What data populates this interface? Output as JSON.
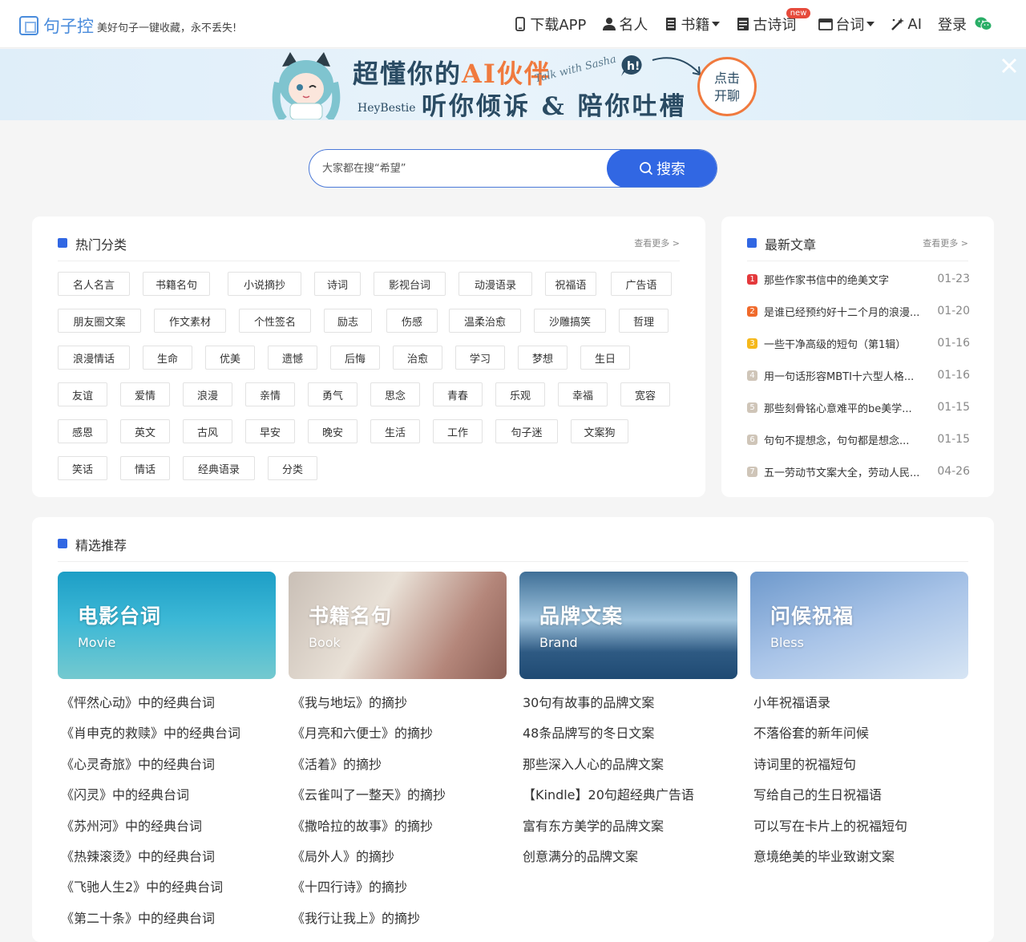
{
  "header": {
    "logo_name": "句子控",
    "slogan": "美好句子一键收藏，永不丢失!",
    "nav": [
      {
        "label": "下载APP",
        "icon": "phone-icon"
      },
      {
        "label": "名人",
        "icon": "person-icon"
      },
      {
        "label": "书籍",
        "icon": "book-icon",
        "dropdown": true
      },
      {
        "label": "古诗词",
        "icon": "document-icon",
        "badge": "new"
      },
      {
        "label": "台词",
        "icon": "clapper-icon",
        "dropdown": true
      },
      {
        "label": "AI",
        "icon": "magic-wand-icon"
      },
      {
        "label": "登录"
      }
    ]
  },
  "banner": {
    "title_pre": "超懂你的",
    "title_ai": "AI伙伴",
    "script": "Talk with Sasha",
    "subtitle": "听你倾诉 & 陪你吐槽",
    "brand": "HeyBestie",
    "cta": [
      "点击",
      "开聊"
    ]
  },
  "search": {
    "placeholder": "大家都在搜“希望”",
    "button": "搜索"
  },
  "hot": {
    "title": "热门分类",
    "more": "查看更多 >",
    "tags": [
      "名人名言",
      "书籍名句",
      "小说摘抄",
      "诗词",
      "影视台词",
      "动漫语录",
      "祝福语",
      "广告语",
      "朋友圈文案",
      "作文素材",
      "个性签名",
      "励志",
      "伤感",
      "温柔治愈",
      "沙雕搞笑",
      "哲理",
      "浪漫情话",
      "生命",
      "优美",
      "遗憾",
      "后悔",
      "治愈",
      "学习",
      "梦想",
      "生日",
      "友谊",
      "爱情",
      "浪漫",
      "亲情",
      "勇气",
      "思念",
      "青春",
      "乐观",
      "幸福",
      "宽容",
      "感恩",
      "英文",
      "古风",
      "早安",
      "晚安",
      "生活",
      "工作",
      "句子迷",
      "文案狗",
      "笑话",
      "情话",
      "经典语录",
      "分类"
    ]
  },
  "latest": {
    "title": "最新文章",
    "more": "查看更多 >",
    "articles": [
      {
        "rank": "1",
        "title": "那些作家书信中的绝美文字",
        "date": "01-23",
        "color": "#e4393c"
      },
      {
        "rank": "2",
        "title": "是谁已经预约好十二个月的浪漫...",
        "date": "01-20",
        "color": "#f06a2b"
      },
      {
        "rank": "3",
        "title": "一些干净高级的短句（第1辑）",
        "date": "01-16",
        "color": "#f5b81b"
      },
      {
        "rank": "4",
        "title": "用一句话形容MBTI十六型人格...",
        "date": "01-16",
        "color": "#cfc5b8"
      },
      {
        "rank": "5",
        "title": "那些刻骨铭心意难平的be美学...",
        "date": "01-15",
        "color": "#cfc5b8"
      },
      {
        "rank": "6",
        "title": "句句不提想念，句句都是想念...",
        "date": "01-15",
        "color": "#cfc5b8"
      },
      {
        "rank": "7",
        "title": "五一劳动节文案大全，劳动人民...",
        "date": "04-26",
        "color": "#cfc5b8"
      }
    ]
  },
  "featured": {
    "title": "精选推荐",
    "columns": [
      {
        "title": "电影台词",
        "sub": "Movie",
        "links": [
          "《怦然心动》中的经典台词",
          "《肖申克的救赎》中的经典台词",
          "《心灵奇旅》中的经典台词",
          "《闪灵》中的经典台词",
          "《苏州河》中的经典台词",
          "《热辣滚烫》中的经典台词",
          "《飞驰人生2》中的经典台词",
          "《第二十条》中的经典台词"
        ]
      },
      {
        "title": "书籍名句",
        "sub": "Book",
        "links": [
          "《我与地坛》的摘抄",
          "《月亮和六便士》的摘抄",
          "《活着》的摘抄",
          "《云雀叫了一整天》的摘抄",
          "《撒哈拉的故事》的摘抄",
          "《局外人》的摘抄",
          "《十四行诗》的摘抄",
          "《我行让我上》的摘抄"
        ]
      },
      {
        "title": "品牌文案",
        "sub": "Brand",
        "links": [
          "30句有故事的品牌文案",
          "48条品牌写的冬日文案",
          "那些深入人心的品牌文案",
          "【Kindle】20句超经典广告语",
          "富有东方美学的品牌文案",
          "创意满分的品牌文案"
        ]
      },
      {
        "title": "问候祝福",
        "sub": "Bless",
        "links": [
          "小年祝福语录",
          "不落俗套的新年问候",
          "诗词里的祝福短句",
          "写给自己的生日祝福语",
          "可以写在卡片上的祝福短句",
          "意境绝美的毕业致谢文案"
        ]
      }
    ]
  }
}
